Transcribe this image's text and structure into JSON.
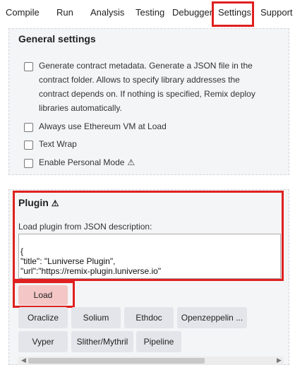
{
  "tabs": [
    "Compile",
    "Run",
    "Analysis",
    "Testing",
    "Debugger",
    "Settings",
    "Support"
  ],
  "general": {
    "title": "General settings",
    "options": [
      {
        "label": "Generate contract metadata. Generate a JSON file in the contract folder. Allows to specify library addresses the contract depends on. If nothing is specified, Remix deploy libraries automatically.",
        "checked": false
      },
      {
        "label": "Always use Ethereum VM at Load",
        "checked": false
      },
      {
        "label": "Text Wrap",
        "checked": false
      },
      {
        "label": "Enable Personal Mode",
        "checked": false
      }
    ]
  },
  "plugin": {
    "title": "Plugin",
    "load_label": "Load plugin from JSON description:",
    "json_lines": [
      "{",
      "\"title\": \"Luniverse Plugin\",",
      "\"url\":\"https://remix-plugin.luniverse.io\"",
      "}"
    ],
    "load_button": "Load",
    "presets": [
      "Oraclize",
      "Solium",
      "Ethdoc",
      "Openzeppelin ...",
      "Vyper",
      "Slither/Mythril",
      "Pipeline"
    ]
  },
  "colors": {
    "highlight": "#e02020",
    "panel": "#f4f5f7",
    "load_button": "#f4c6c6"
  }
}
